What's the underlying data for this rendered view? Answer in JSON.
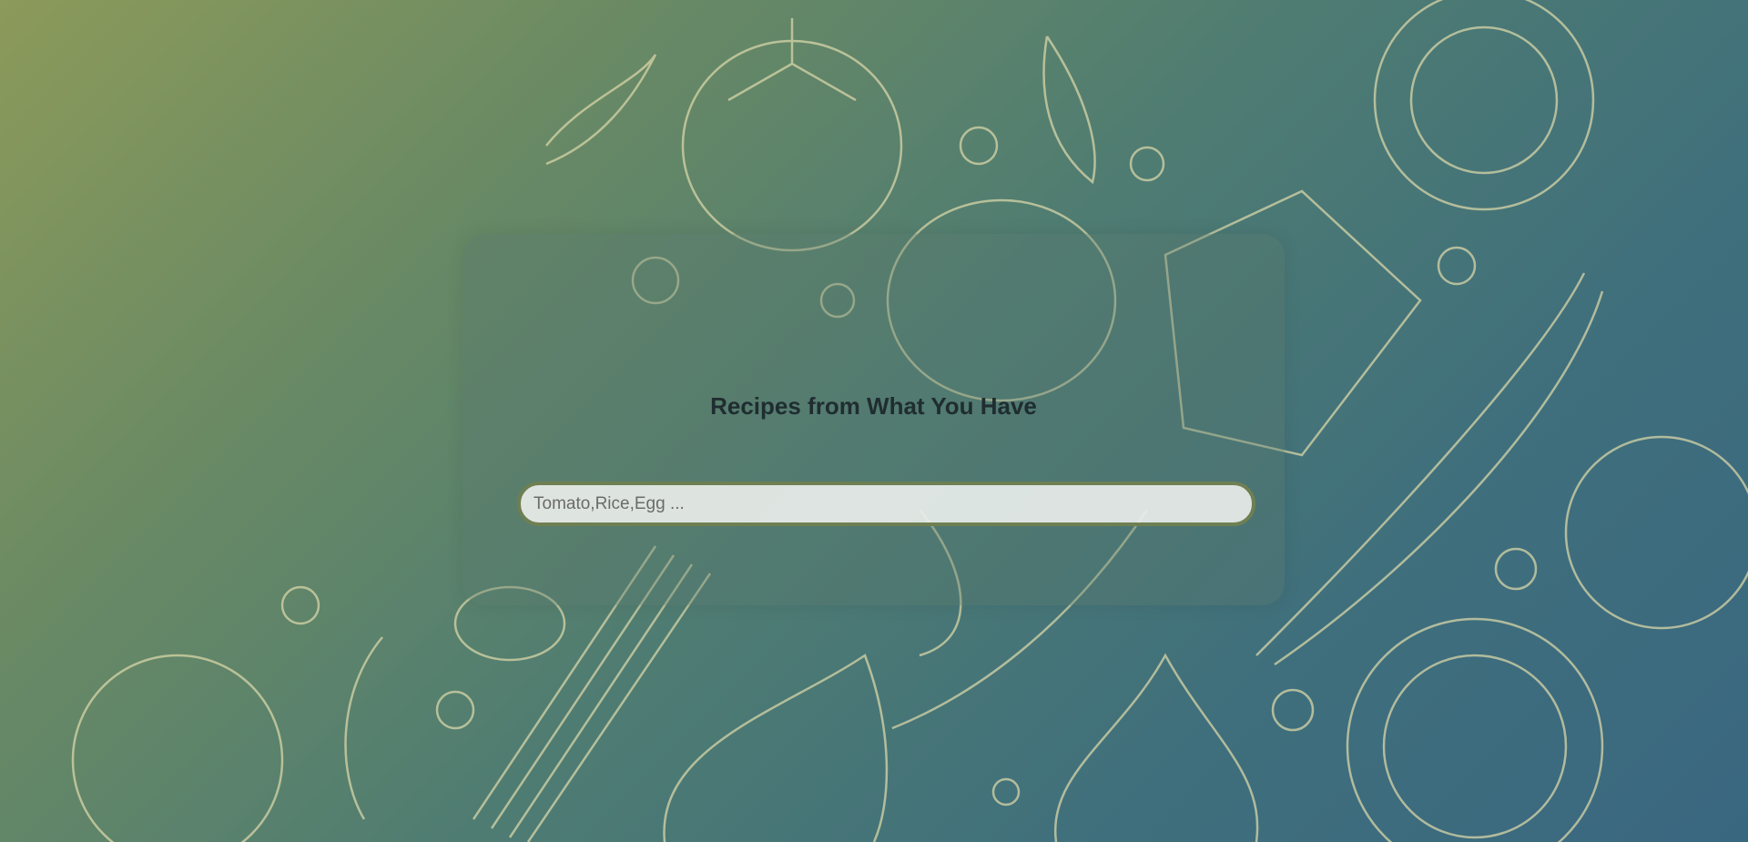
{
  "main": {
    "title": "Recipes from What You Have",
    "search": {
      "placeholder": "Tomato,Rice,Egg ...",
      "value": ""
    }
  },
  "colors": {
    "accent": "#6e7f52",
    "title": "#1f2d30"
  }
}
